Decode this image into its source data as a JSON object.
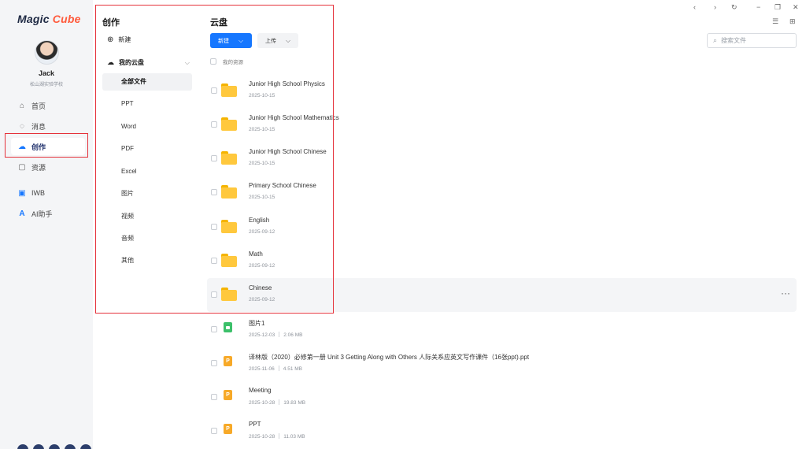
{
  "app": {
    "logo_text_a": "Magic ",
    "logo_text_b": "Cube"
  },
  "user": {
    "name": "Jack",
    "school": "松山湖实验学校"
  },
  "nav": [
    {
      "label": "首页",
      "icon": "home-icon"
    },
    {
      "label": "消息",
      "icon": "message-icon"
    },
    {
      "label": "创作",
      "icon": "cloud-create-icon"
    },
    {
      "label": "资源",
      "icon": "resource-icon"
    },
    {
      "label": "IWB",
      "icon": "whiteboard-icon"
    },
    {
      "label": "AI助手",
      "icon": "ai-assistant-icon"
    }
  ],
  "categories": {
    "title": "创作",
    "new_label": "新建",
    "cloud_label": "我的云盘",
    "items": [
      "全部文件",
      "PPT",
      "Word",
      "PDF",
      "Excel",
      "图片",
      "视频",
      "音频",
      "其他"
    ]
  },
  "main": {
    "title": "云盘",
    "new_button": "新建",
    "upload_button": "上传",
    "breadcrumb": "我的资源",
    "search_placeholder": "搜索文件"
  },
  "files": [
    {
      "name": "Junior High School Physics",
      "date": "2025-10-15",
      "size": "",
      "type": "folder"
    },
    {
      "name": "Junior High School Mathematics",
      "date": "2025-10-15",
      "size": "",
      "type": "folder"
    },
    {
      "name": "Junior High School Chinese",
      "date": "2025-10-15",
      "size": "",
      "type": "folder"
    },
    {
      "name": "Primary School Chinese",
      "date": "2025-10-15",
      "size": "",
      "type": "folder"
    },
    {
      "name": "English",
      "date": "2025-09-12",
      "size": "",
      "type": "folder"
    },
    {
      "name": "Math",
      "date": "2025-09-12",
      "size": "",
      "type": "folder"
    },
    {
      "name": "Chinese",
      "date": "2025-09-12",
      "size": "",
      "type": "folder"
    },
    {
      "name": "图片1",
      "date": "2025-12-03",
      "size": "2.06 MB",
      "type": "image"
    },
    {
      "name": "译林版（2020）必修第一册 Unit 3 Getting Along with Others 人际关系应英文写作课件（16张ppt).ppt",
      "date": "2025-11-06",
      "size": "4.51 MB",
      "type": "ppt"
    },
    {
      "name": "Meeting",
      "date": "2025-10-28",
      "size": "19.83 MB",
      "type": "ppt"
    },
    {
      "name": "PPT",
      "date": "2025-10-28",
      "size": "11.03 MB",
      "type": "ppt"
    }
  ],
  "more_icon": "more-horizontal-icon"
}
